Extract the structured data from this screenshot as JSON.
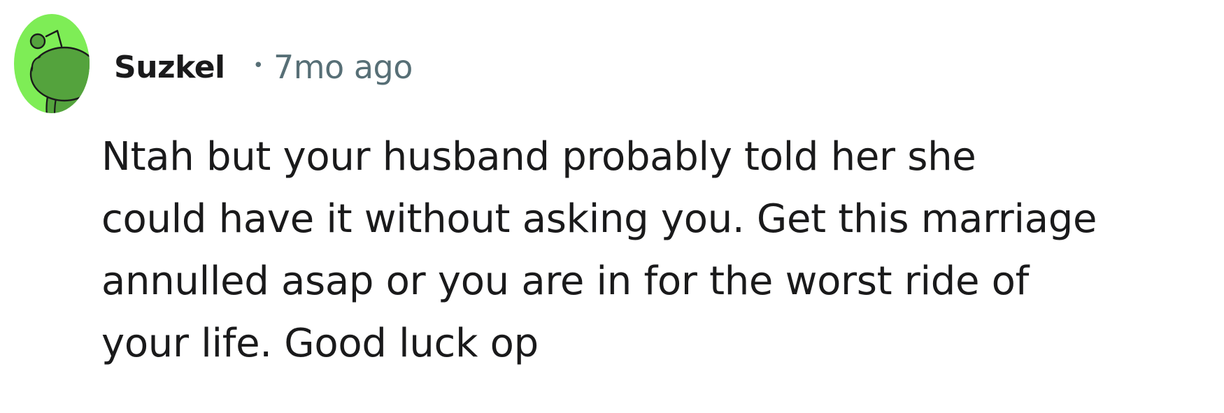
{
  "comment": {
    "author": "Suzkel",
    "separator": "•",
    "time_ago": "7mo ago",
    "body_lines": [
      "Ntah but your husband probably told her she",
      "could have it without asking you. Get this marriage",
      "annulled asap or you are in for the worst ride of",
      "your life. Good luck op"
    ],
    "avatar": {
      "icon": "snoo-avatar-icon",
      "background_color": "#7eed56",
      "figure_color": "#54a33d"
    }
  }
}
